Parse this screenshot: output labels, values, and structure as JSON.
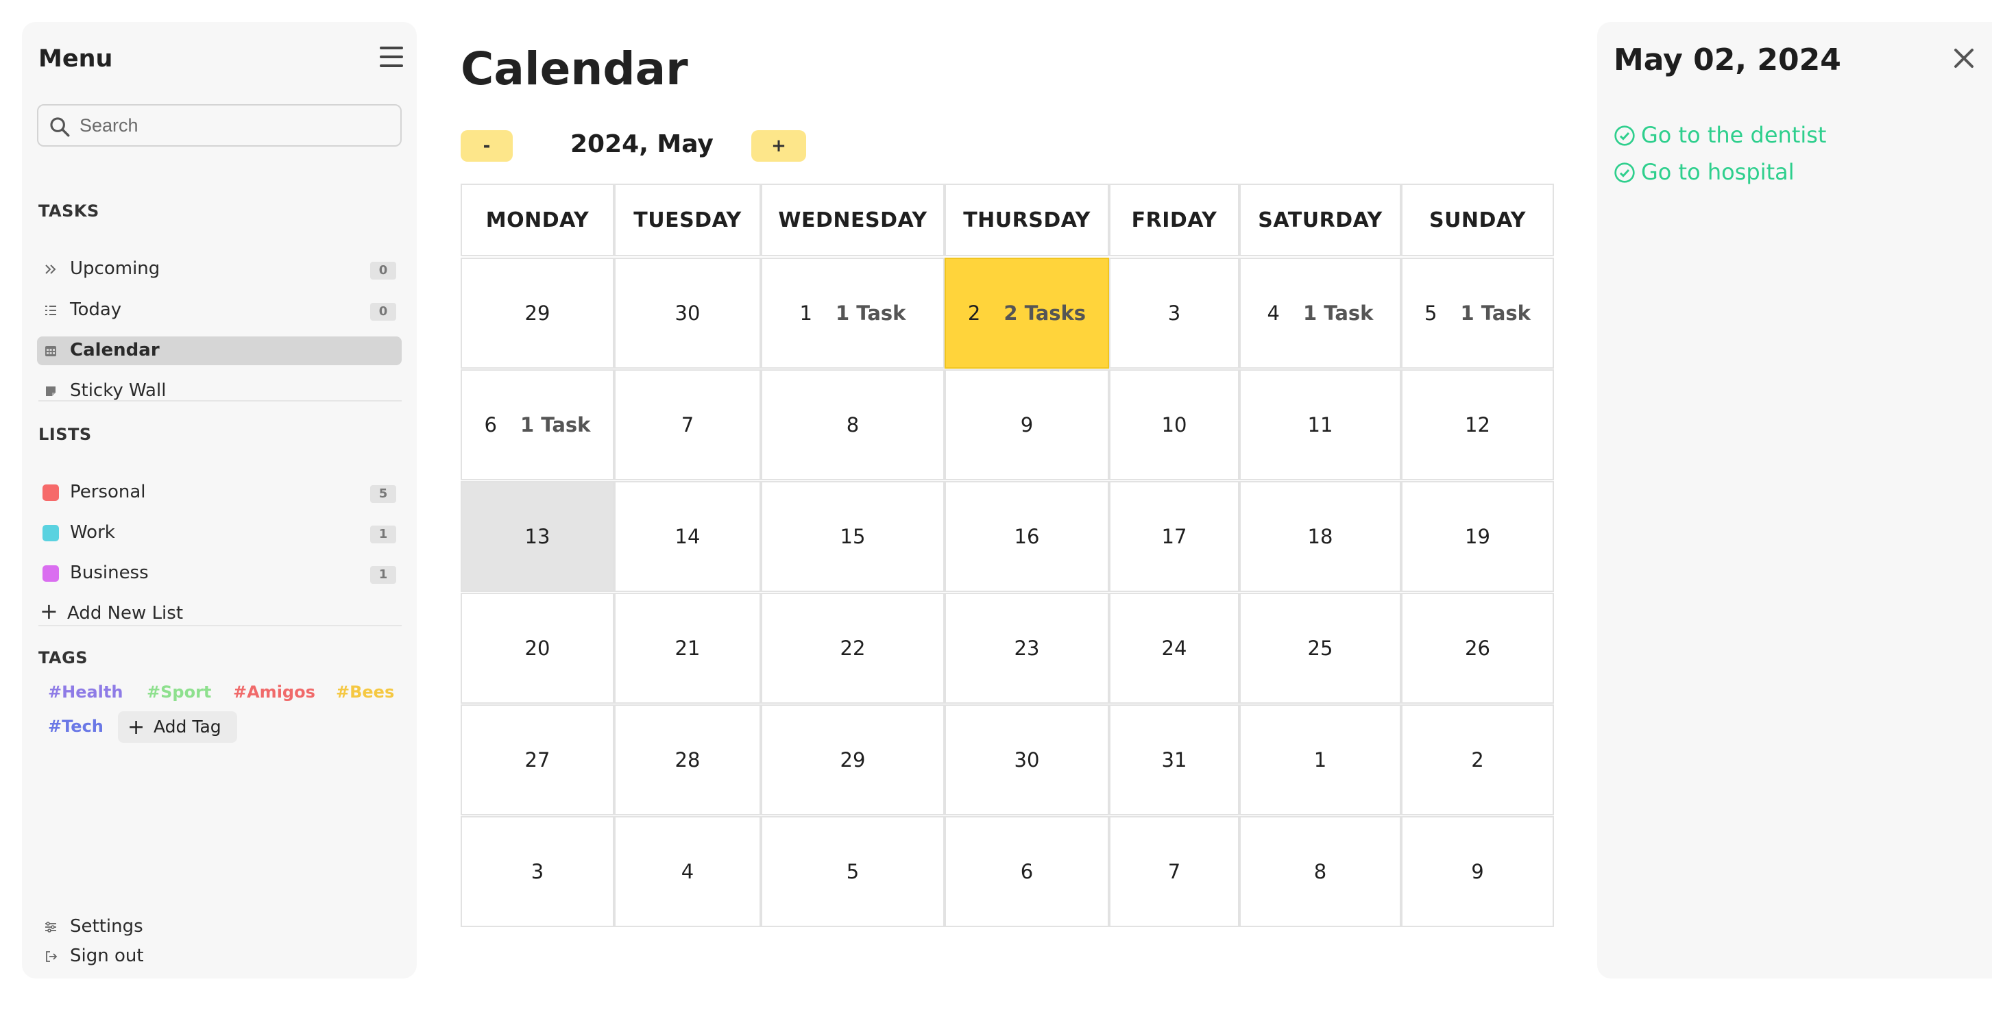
{
  "sidebar": {
    "title": "Menu",
    "search_placeholder": "Search",
    "tasks_label": "TASKS",
    "tasks": [
      {
        "label": "Upcoming",
        "count": "0"
      },
      {
        "label": "Today",
        "count": "0"
      },
      {
        "label": "Calendar"
      },
      {
        "label": "Sticky Wall"
      }
    ],
    "lists_label": "LISTS",
    "lists": [
      {
        "label": "Personal",
        "count": "5",
        "color": "#f66a6a"
      },
      {
        "label": "Work",
        "count": "1",
        "color": "#5ad2e0"
      },
      {
        "label": "Business",
        "count": "1",
        "color": "#da6ef0"
      }
    ],
    "add_list_label": "Add New List",
    "tags_label": "TAGS",
    "tags": [
      {
        "label": "#Health",
        "color": "#8e7be6"
      },
      {
        "label": "#Sport",
        "color": "#8ee08e"
      },
      {
        "label": "#Amigos",
        "color": "#f06a6a"
      },
      {
        "label": "#Bees",
        "color": "#f5c842"
      },
      {
        "label": "#Tech",
        "color": "#6a78e6"
      }
    ],
    "add_tag_label": "Add Tag",
    "settings_label": "Settings",
    "signout_label": "Sign out"
  },
  "main": {
    "title": "Calendar",
    "prev_label": "-",
    "next_label": "+",
    "month_label": "2024, May",
    "weekdays": [
      "MONDAY",
      "TUESDAY",
      "WEDNESDAY",
      "THURSDAY",
      "FRIDAY",
      "SATURDAY",
      "SUNDAY"
    ],
    "weeks": [
      [
        {
          "d": "29"
        },
        {
          "d": "30"
        },
        {
          "d": "1",
          "t": "1 Task"
        },
        {
          "d": "2",
          "t": "2 Tasks"
        },
        {
          "d": "3"
        },
        {
          "d": "4",
          "t": "1 Task"
        },
        {
          "d": "5",
          "t": "1 Task"
        }
      ],
      [
        {
          "d": "6",
          "t": "1 Task"
        },
        {
          "d": "7"
        },
        {
          "d": "8"
        },
        {
          "d": "9"
        },
        {
          "d": "10"
        },
        {
          "d": "11"
        },
        {
          "d": "12"
        }
      ],
      [
        {
          "d": "13"
        },
        {
          "d": "14"
        },
        {
          "d": "15"
        },
        {
          "d": "16"
        },
        {
          "d": "17"
        },
        {
          "d": "18"
        },
        {
          "d": "19"
        }
      ],
      [
        {
          "d": "20"
        },
        {
          "d": "21"
        },
        {
          "d": "22"
        },
        {
          "d": "23"
        },
        {
          "d": "24"
        },
        {
          "d": "25"
        },
        {
          "d": "26"
        }
      ],
      [
        {
          "d": "27"
        },
        {
          "d": "28"
        },
        {
          "d": "29"
        },
        {
          "d": "30"
        },
        {
          "d": "31"
        },
        {
          "d": "1"
        },
        {
          "d": "2"
        }
      ],
      [
        {
          "d": "3"
        },
        {
          "d": "4"
        },
        {
          "d": "5"
        },
        {
          "d": "6"
        },
        {
          "d": "7"
        },
        {
          "d": "8"
        },
        {
          "d": "9"
        }
      ]
    ],
    "selected_color": "#ffd43b",
    "today_color": "#e4e4e4"
  },
  "detail": {
    "date": "May 02, 2024",
    "tasks": [
      "Go to the dentist",
      "Go to hospital"
    ],
    "task_color": "#2ecf8d"
  }
}
